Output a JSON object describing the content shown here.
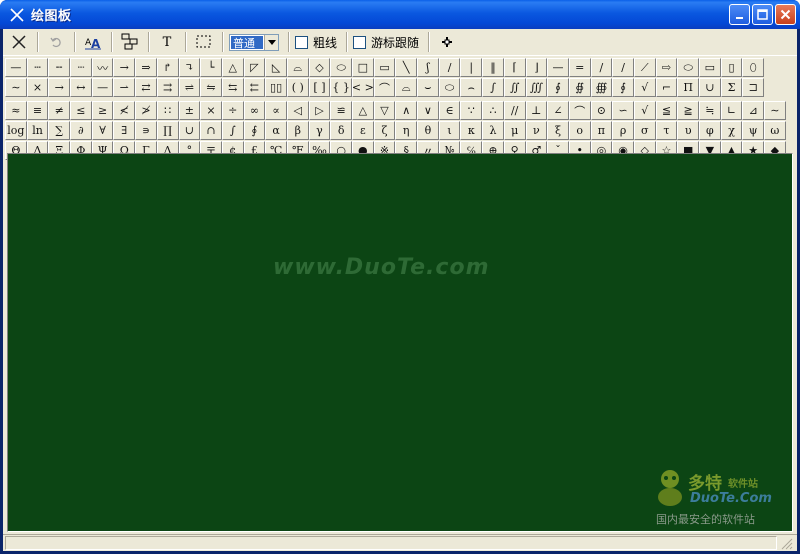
{
  "window": {
    "title": "绘图板"
  },
  "toolbar": {
    "line_style_value": "普通",
    "bold_label": "粗线",
    "cursor_follow_label": "游标跟随",
    "text_tool_label": "T",
    "fontsize_label": "A"
  },
  "palette": {
    "row1": [
      "—",
      "┄",
      "╌",
      "┈",
      "〰",
      "→",
      "⇒",
      "↱",
      "↴",
      "└",
      "△",
      "◸",
      "◺",
      "⌓",
      "◇",
      "⬭",
      "□",
      "▭",
      "╲",
      "ʃ",
      "∕",
      "|",
      "‖",
      "⌈",
      "⌋",
      "—",
      "=",
      "/",
      "∕",
      "⟋",
      "⇨",
      "⬭",
      "▭",
      "▯",
      "⬯"
    ],
    "row2": [
      "∼",
      "×",
      "→",
      "↔",
      "—",
      "⇀",
      "⇄",
      "⇉",
      "⇌",
      "⇋",
      "⇆",
      "⇇",
      "▯▯",
      "( )",
      "[ ]",
      "{ }",
      "< >",
      "⌒",
      "⌓",
      "⌣",
      "⬭",
      "⌢",
      "∫",
      "∬",
      "∭",
      "∮",
      "∯",
      "∰",
      "∮",
      "√",
      "⌐",
      "Π",
      "∪",
      "Σ",
      "⊐"
    ],
    "row3": [
      "≈",
      "≡",
      "≠",
      "≤",
      "≥",
      "≮",
      "≯",
      "∷",
      "±",
      "×",
      "÷",
      "∞",
      "∝",
      "◁",
      "▷",
      "≌",
      "△",
      "▽",
      "∧",
      "∨",
      "∈",
      "∵",
      "∴",
      "//",
      "⊥",
      "∠",
      "⌒",
      "⊙",
      "∽",
      "√",
      "≦",
      "≧",
      "≒",
      "∟",
      "⊿",
      "∼"
    ],
    "row4": [
      "log",
      "ln",
      "∑",
      "∂",
      "∀",
      "∃",
      "∍",
      "∏",
      "∪",
      "∩",
      "∫",
      "∮",
      "α",
      "β",
      "γ",
      "δ",
      "ε",
      "ζ",
      "η",
      "θ",
      "ι",
      "κ",
      "λ",
      "μ",
      "ν",
      "ξ",
      "ο",
      "π",
      "ρ",
      "σ",
      "τ",
      "υ",
      "φ",
      "χ",
      "ψ",
      "ω"
    ],
    "row5": [
      "Θ",
      "Λ",
      "Ξ",
      "Φ",
      "Ψ",
      "Ω",
      "Γ",
      "Δ",
      "°",
      "〒",
      "¢",
      "£",
      "℃",
      "℉",
      "‰",
      "○",
      "●",
      "※",
      "§",
      "〃",
      "№",
      "℅",
      "⊕",
      "♀",
      "♂",
      "ˇ",
      "•",
      "◎",
      "◉",
      "◇",
      "☆",
      "■",
      "▼",
      "▲",
      "★",
      "◆"
    ]
  },
  "canvas": {
    "watermark": "www.DuoTe.com",
    "logo_cn": "多特",
    "logo_sub": "软件站",
    "logo_en": "DuoTe.Com",
    "logo_line": "国内最安全的软件站"
  }
}
